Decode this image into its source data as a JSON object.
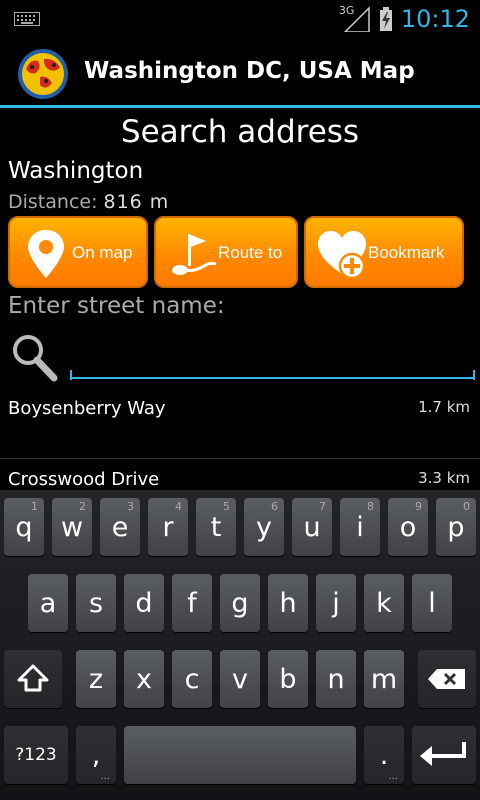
{
  "status_bar": {
    "network": "3G",
    "time": "10:12"
  },
  "action_bar": {
    "title": "Washington DC, USA Map",
    "logo_icon": "world-map-icon"
  },
  "search": {
    "section_title": "Search address",
    "place_name": "Washington",
    "distance_label": "Distance:",
    "distance_value": "816  m",
    "buttons": {
      "on_map": "On map",
      "route_to": "Route to",
      "bookmark": "Bookmark"
    },
    "street_label": "Enter street name:",
    "street_value": ""
  },
  "results": [
    {
      "name": "Boysenberry Way",
      "distance": "1.7 km"
    },
    {
      "name": "Crosswood Drive",
      "distance": "3.3 km"
    }
  ],
  "keyboard": {
    "row1": [
      {
        "k": "q",
        "h": "1"
      },
      {
        "k": "w",
        "h": "2"
      },
      {
        "k": "e",
        "h": "3"
      },
      {
        "k": "r",
        "h": "4"
      },
      {
        "k": "t",
        "h": "5"
      },
      {
        "k": "y",
        "h": "6"
      },
      {
        "k": "u",
        "h": "7"
      },
      {
        "k": "i",
        "h": "8"
      },
      {
        "k": "o",
        "h": "9"
      },
      {
        "k": "p",
        "h": "0"
      }
    ],
    "row2": [
      "a",
      "s",
      "d",
      "f",
      "g",
      "h",
      "j",
      "k",
      "l"
    ],
    "row3": [
      "z",
      "x",
      "c",
      "v",
      "b",
      "n",
      "m"
    ],
    "symbols_key": "?123",
    "comma_key": ",",
    "period_key": ".",
    "key_dots": "...",
    "shift_icon": "shift-arrow-icon",
    "delete_icon": "backspace-icon",
    "enter_icon": "enter-arrow-icon"
  },
  "colors": {
    "accent": "#33b5e5",
    "button_orange": "#ff8a00"
  }
}
